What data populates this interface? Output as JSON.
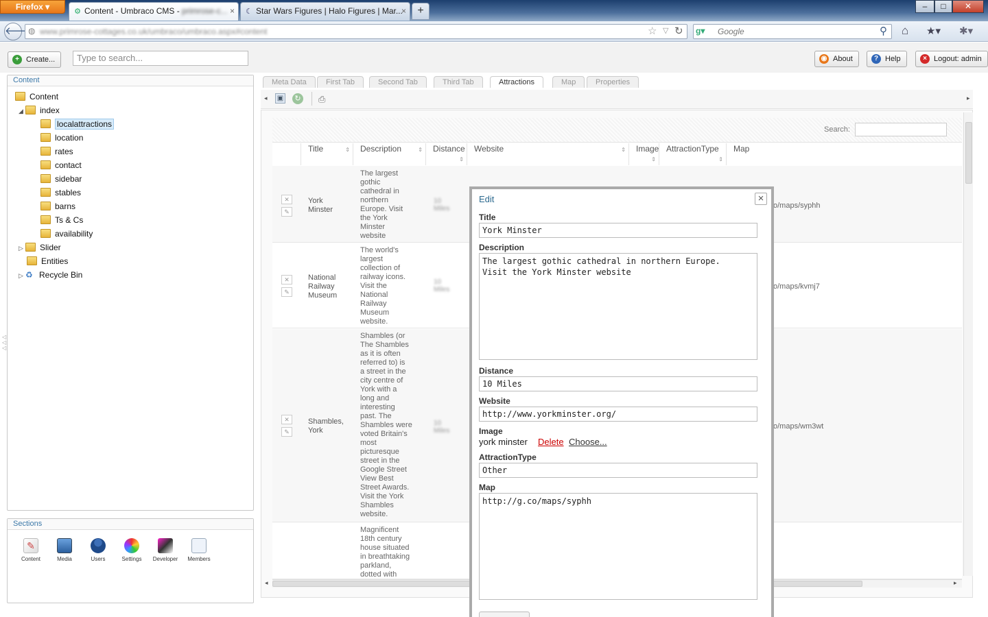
{
  "browser": {
    "app_button": "Firefox",
    "tabs": [
      {
        "title": "Content - Umbraco CMS - ",
        "active": true
      },
      {
        "title": "Star Wars Figures | Halo Figures | Mar...",
        "active": false
      }
    ],
    "new_tab": "+",
    "window_buttons": [
      "–",
      "□",
      "✕"
    ],
    "url": "www.primrose-cottages.co.uk/umbraco/umbraco.aspx#content",
    "search_placeholder": "Google"
  },
  "header": {
    "create_label": "Create...",
    "search_placeholder": "Type to search...",
    "about_label": "About",
    "help_label": "Help",
    "logout_label": "Logout: admin"
  },
  "tree": {
    "heading": "Content",
    "root": "Content",
    "index": "index",
    "children": [
      "localattractions",
      "location",
      "rates",
      "contact",
      "sidebar",
      "stables",
      "barns",
      "Ts & Cs",
      "availability"
    ],
    "slider": "Slider",
    "entities": "Entities",
    "recycle": "Recycle Bin"
  },
  "sections": {
    "heading": "Sections",
    "items": [
      "Content",
      "Media",
      "Users",
      "Settings",
      "Developer",
      "Members"
    ]
  },
  "content_tabs": [
    "Meta Data",
    "First Tab",
    "Second Tab",
    "Third Tab",
    "Attractions",
    "Map",
    "Properties"
  ],
  "grid": {
    "search_label": "Search:",
    "columns": [
      "Title",
      "Description",
      "Distance",
      "Website",
      "Image",
      "AttractionType",
      "Map"
    ],
    "rows": [
      {
        "title": "York\nMinster",
        "description": "The largest\ngothic\ncathedral in\nnorthern\nEurope. Visit\nthe York\nMinster\nwebsite",
        "distance": "10\nMiles",
        "map": "o/maps/syphh"
      },
      {
        "title": "National\nRailway\nMuseum",
        "description": "The world's\nlargest\ncollection of\nrailway icons.\nVisit the\nNational\nRailway\nMuseum\nwebsite.",
        "distance": "10\nMiles",
        "map": "o/maps/kvmj7"
      },
      {
        "title": "Shambles,\nYork",
        "description": "Shambles (or\nThe Shambles\nas it is often\nreferred to) is\na street in the\ncity centre of\nYork with a\nlong and\ninteresting\npast. The\nShambles were\nvoted Britain's\nmost\npicturesque\nstreet in the\nGoogle Street\nView Best\nStreet Awards.\nVisit the York\nShambles\nwebsite.",
        "distance": "10\nMiles",
        "map": "o/maps/wm3wt"
      },
      {
        "title": "",
        "description": "Magnificent\n18th century\nhouse situated\nin breathtaking\nparkland,\ndotted with",
        "distance": "",
        "map": ""
      }
    ]
  },
  "dialog": {
    "title": "Edit",
    "close": "×",
    "title_label": "Title",
    "title_value": "York Minster",
    "description_label": "Description",
    "description_value": "The largest gothic cathedral in northern Europe.  Visit the York Minster website",
    "distance_label": "Distance",
    "distance_value": "10 Miles",
    "website_label": "Website",
    "website_value": "http://www.yorkminster.org/",
    "image_label": "Image",
    "image_value": "york minster",
    "image_delete": "Delete",
    "image_choose": "Choose...",
    "type_label": "AttractionType",
    "type_value": "Other",
    "map_label": "Map",
    "map_value": "http://g.co/maps/syphh"
  }
}
